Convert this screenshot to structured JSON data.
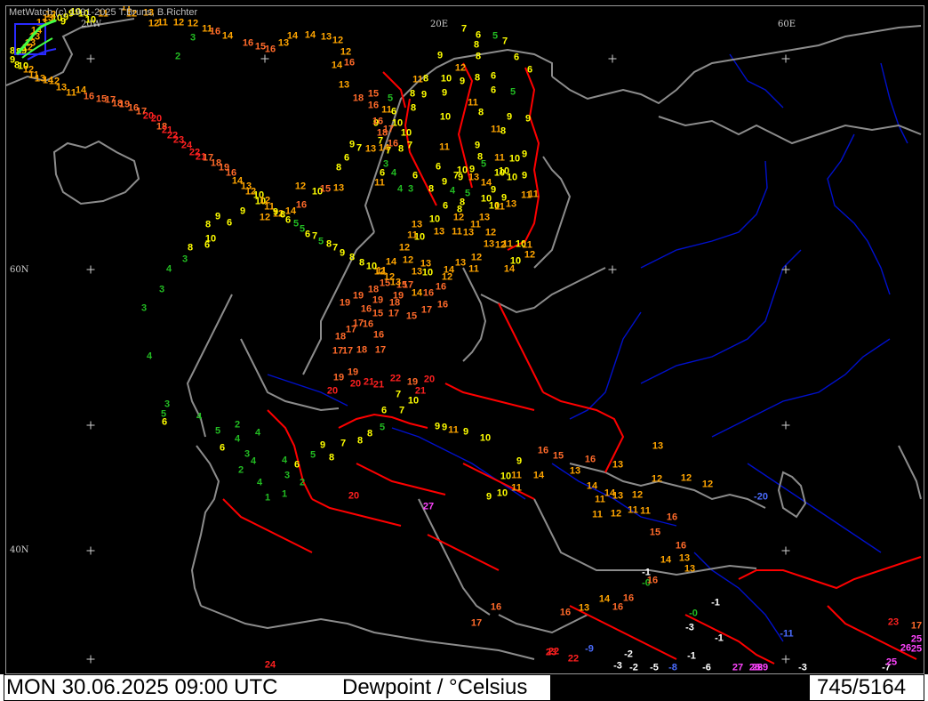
{
  "app": {
    "copyright": "MetWatch  (c) 1991-2025 T.Bruns, B.Richter"
  },
  "status_bar": {
    "datetime": "MON 30.06.2025 09:00 UTC",
    "parameter": "Dewpoint / °Celsius",
    "station_count": "745/5164"
  },
  "graticule_labels": {
    "lon_20w": "20W",
    "lon_20e": "20E",
    "lon_60e": "60E",
    "lat_60n": "60N",
    "lat_40n": "40N"
  },
  "colors": {
    "background": "#000000",
    "coast": "#8c8c8c",
    "border": "#ff0000",
    "river": "#0000cc",
    "value_scale": [
      {
        "max": -8,
        "color": "#4a6cff"
      },
      {
        "max": -1,
        "color": "#ffffff"
      },
      {
        "max": 5,
        "color": "#22bb22"
      },
      {
        "max": 10,
        "color": "#ffff00"
      },
      {
        "max": 14,
        "color": "#ffa500"
      },
      {
        "max": 19,
        "color": "#ff6a2a"
      },
      {
        "max": 24,
        "color": "#ff2020"
      },
      {
        "max": 40,
        "color": "#ff44ff"
      }
    ]
  },
  "observations": [
    {
      "v": "2"
    },
    {
      "v": "3"
    },
    {
      "v": "7"
    },
    {
      "v": "6"
    },
    {
      "v": "5"
    },
    {
      "v": "9"
    },
    {
      "v": "8"
    },
    {
      "v": "6"
    },
    {
      "v": "7"
    },
    {
      "v": "6"
    },
    {
      "v": "9"
    },
    {
      "v": "8"
    },
    {
      "v": "8"
    },
    {
      "v": "10"
    },
    {
      "v": "12"
    },
    {
      "v": "8"
    },
    {
      "v": "6"
    },
    {
      "v": "9"
    },
    {
      "v": "8"
    },
    {
      "v": "11"
    },
    {
      "v": "9"
    },
    {
      "v": "8"
    },
    {
      "v": "6"
    },
    {
      "v": "5"
    },
    {
      "v": "11"
    },
    {
      "v": "10"
    },
    {
      "v": "9"
    },
    {
      "v": "10"
    },
    {
      "v": "11"
    },
    {
      "v": "8"
    },
    {
      "v": "6"
    },
    {
      "v": "5"
    },
    {
      "v": "9"
    },
    {
      "v": "9"
    },
    {
      "v": "11"
    },
    {
      "v": "8"
    },
    {
      "v": "10"
    },
    {
      "v": "7"
    },
    {
      "v": "7"
    },
    {
      "v": "8"
    },
    {
      "v": "7"
    },
    {
      "v": "11"
    },
    {
      "v": "9"
    },
    {
      "v": "8"
    },
    {
      "v": "5"
    },
    {
      "v": "3"
    },
    {
      "v": "6"
    },
    {
      "v": "4"
    },
    {
      "v": "4"
    },
    {
      "v": "3"
    },
    {
      "v": "6"
    },
    {
      "v": "6"
    },
    {
      "v": "9"
    },
    {
      "v": "8"
    },
    {
      "v": "10"
    },
    {
      "v": "9"
    },
    {
      "v": "9"
    },
    {
      "v": "13"
    },
    {
      "v": "14"
    },
    {
      "v": "11"
    },
    {
      "v": "10"
    },
    {
      "v": "10"
    },
    {
      "v": "9"
    },
    {
      "v": "9"
    },
    {
      "v": "11"
    },
    {
      "v": "10"
    },
    {
      "v": "10"
    },
    {
      "v": "9"
    },
    {
      "v": "7"
    },
    {
      "v": "4"
    },
    {
      "v": "5"
    },
    {
      "v": "8"
    },
    {
      "v": "6"
    },
    {
      "v": "8"
    },
    {
      "v": "10"
    },
    {
      "v": "10"
    },
    {
      "v": "9"
    },
    {
      "v": "11"
    },
    {
      "v": "11"
    },
    {
      "v": "13"
    },
    {
      "v": "11"
    },
    {
      "v": "13"
    },
    {
      "v": "12"
    },
    {
      "v": "11"
    },
    {
      "v": "10"
    },
    {
      "v": "13"
    },
    {
      "v": "10"
    },
    {
      "v": "11"
    },
    {
      "v": "12"
    },
    {
      "v": "13"
    },
    {
      "v": "11"
    },
    {
      "v": "13"
    },
    {
      "v": "12"
    },
    {
      "v": "13"
    },
    {
      "v": "12"
    },
    {
      "v": "11"
    },
    {
      "v": "10"
    },
    {
      "v": "11"
    },
    {
      "v": "12"
    },
    {
      "v": "10"
    },
    {
      "v": "14"
    },
    {
      "v": "12"
    },
    {
      "v": "13"
    },
    {
      "v": "11"
    },
    {
      "v": "14"
    },
    {
      "v": "12"
    },
    {
      "v": "10"
    },
    {
      "v": "13"
    },
    {
      "v": "13"
    },
    {
      "v": "12"
    },
    {
      "v": "14"
    },
    {
      "v": "12"
    },
    {
      "v": "15"
    },
    {
      "v": "15"
    },
    {
      "v": "14"
    },
    {
      "v": "16"
    },
    {
      "v": "16"
    },
    {
      "v": "16"
    },
    {
      "v": "17"
    },
    {
      "v": "15"
    },
    {
      "v": "17"
    },
    {
      "v": "15"
    },
    {
      "v": "17"
    },
    {
      "v": "16"
    },
    {
      "v": "16"
    },
    {
      "v": "16"
    },
    {
      "v": "17"
    },
    {
      "v": "18"
    },
    {
      "v": "17"
    },
    {
      "v": "17"
    },
    {
      "v": "18"
    },
    {
      "v": "17"
    },
    {
      "v": "19"
    },
    {
      "v": "19"
    },
    {
      "v": "18"
    },
    {
      "v": "19"
    },
    {
      "v": "18"
    },
    {
      "v": "19"
    },
    {
      "v": "17"
    },
    {
      "v": "19"
    },
    {
      "v": "20"
    },
    {
      "v": "19"
    },
    {
      "v": "20"
    },
    {
      "v": "21"
    },
    {
      "v": "21"
    },
    {
      "v": "22"
    },
    {
      "v": "19"
    },
    {
      "v": "21"
    },
    {
      "v": "20"
    },
    {
      "v": "20"
    },
    {
      "v": "27"
    },
    {
      "v": "-20"
    },
    {
      "v": "-1"
    },
    {
      "v": "-0"
    },
    {
      "v": "-0"
    },
    {
      "v": "-3"
    },
    {
      "v": "-1"
    },
    {
      "v": "-1"
    },
    {
      "v": "-2"
    },
    {
      "v": "-3"
    },
    {
      "v": "-2"
    },
    {
      "v": "-5"
    },
    {
      "v": "-8"
    },
    {
      "v": "-6"
    },
    {
      "v": "-7"
    },
    {
      "v": "-9"
    },
    {
      "v": "-11"
    },
    {
      "v": "-1"
    },
    {
      "v": "-3"
    },
    {
      "v": "25"
    },
    {
      "v": "26"
    },
    {
      "v": "25"
    },
    {
      "v": "25"
    },
    {
      "v": "26"
    },
    {
      "v": "27"
    },
    {
      "v": "29"
    },
    {
      "v": "28"
    },
    {
      "v": "23"
    },
    {
      "v": "22"
    },
    {
      "v": "22"
    },
    {
      "v": "24"
    },
    {
      "v": "23"
    },
    {
      "v": "17"
    },
    {
      "v": "17"
    },
    {
      "v": "16"
    },
    {
      "v": "16"
    },
    {
      "v": "13"
    },
    {
      "v": "14"
    },
    {
      "v": "16"
    },
    {
      "v": "16"
    },
    {
      "v": "16"
    },
    {
      "v": "13"
    },
    {
      "v": "13"
    },
    {
      "v": "14"
    },
    {
      "v": "16"
    },
    {
      "v": "15"
    },
    {
      "v": "16"
    },
    {
      "v": "11"
    },
    {
      "v": "11"
    },
    {
      "v": "12"
    },
    {
      "v": "12"
    },
    {
      "v": "13"
    },
    {
      "v": "14"
    },
    {
      "v": "14"
    },
    {
      "v": "11"
    },
    {
      "v": "11"
    },
    {
      "v": "12"
    },
    {
      "v": "12"
    },
    {
      "v": "12"
    },
    {
      "v": "13"
    },
    {
      "v": "13"
    },
    {
      "v": "16"
    },
    {
      "v": "13"
    },
    {
      "v": "15"
    },
    {
      "v": "16"
    },
    {
      "v": "14"
    },
    {
      "v": "11"
    },
    {
      "v": "10"
    },
    {
      "v": "11"
    },
    {
      "v": "10"
    },
    {
      "v": "9"
    },
    {
      "v": "9"
    },
    {
      "v": "10"
    },
    {
      "v": "9"
    },
    {
      "v": "11"
    },
    {
      "v": "9"
    },
    {
      "v": "9"
    },
    {
      "v": "10"
    },
    {
      "v": "7"
    },
    {
      "v": "7"
    },
    {
      "v": "6"
    },
    {
      "v": "5"
    },
    {
      "v": "8"
    },
    {
      "v": "8"
    },
    {
      "v": "7"
    },
    {
      "v": "9"
    },
    {
      "v": "8"
    },
    {
      "v": "5"
    },
    {
      "v": "6"
    },
    {
      "v": "4"
    },
    {
      "v": "3"
    },
    {
      "v": "2"
    },
    {
      "v": "1"
    },
    {
      "v": "1"
    },
    {
      "v": "4"
    },
    {
      "v": "4"
    },
    {
      "v": "2"
    },
    {
      "v": "3"
    },
    {
      "v": "4"
    },
    {
      "v": "2"
    },
    {
      "v": "4"
    },
    {
      "v": "6"
    },
    {
      "v": "5"
    },
    {
      "v": "4"
    },
    {
      "v": "6"
    },
    {
      "v": "5"
    },
    {
      "v": "3"
    },
    {
      "v": "4"
    },
    {
      "v": "3"
    },
    {
      "v": "3"
    },
    {
      "v": "4"
    },
    {
      "v": "3"
    },
    {
      "v": "8"
    },
    {
      "v": "6"
    },
    {
      "v": "10"
    },
    {
      "v": "8"
    },
    {
      "v": "9"
    },
    {
      "v": "6"
    },
    {
      "v": "9"
    },
    {
      "v": "10"
    },
    {
      "v": "12"
    },
    {
      "v": "12"
    },
    {
      "v": "14"
    },
    {
      "v": "16"
    },
    {
      "v": "12"
    },
    {
      "v": "10"
    },
    {
      "v": "15"
    },
    {
      "v": "13"
    },
    {
      "v": "8"
    },
    {
      "v": "6"
    },
    {
      "v": "9"
    },
    {
      "v": "7"
    },
    {
      "v": "13"
    },
    {
      "v": "14"
    },
    {
      "v": "16"
    },
    {
      "v": "17"
    },
    {
      "v": "18"
    },
    {
      "v": "16"
    },
    {
      "v": "16"
    },
    {
      "v": "15"
    },
    {
      "v": "18"
    },
    {
      "v": "13"
    },
    {
      "v": "14"
    },
    {
      "v": "16"
    },
    {
      "v": "12"
    },
    {
      "v": "12"
    },
    {
      "v": "13"
    },
    {
      "v": "14"
    },
    {
      "v": "14"
    },
    {
      "v": "13"
    },
    {
      "v": "16"
    },
    {
      "v": "15"
    },
    {
      "v": "16"
    },
    {
      "v": "14"
    },
    {
      "v": "16"
    },
    {
      "v": "11"
    },
    {
      "v": "12"
    },
    {
      "v": "12"
    },
    {
      "v": "11"
    },
    {
      "v": "12"
    },
    {
      "v": "13"
    },
    {
      "v": "12"
    },
    {
      "v": "11"
    },
    {
      "v": "11"
    },
    {
      "v": "10"
    },
    {
      "v": "10"
    },
    {
      "v": "10"
    },
    {
      "v": "9"
    },
    {
      "v": "9"
    },
    {
      "v": "9"
    },
    {
      "v": "10"
    },
    {
      "v": "12"
    },
    {
      "v": "13"
    },
    {
      "v": "13"
    },
    {
      "v": "14"
    },
    {
      "v": "13"
    },
    {
      "v": "13"
    },
    {
      "v": "12"
    },
    {
      "v": "9"
    },
    {
      "v": "8"
    },
    {
      "v": "8"
    },
    {
      "v": "9"
    },
    {
      "v": "8"
    },
    {
      "v": "10"
    },
    {
      "v": "12"
    },
    {
      "v": "11"
    },
    {
      "v": "13"
    },
    {
      "v": "14"
    },
    {
      "v": "12"
    },
    {
      "v": "13"
    },
    {
      "v": "11"
    },
    {
      "v": "14"
    },
    {
      "v": "16"
    },
    {
      "v": "15"
    },
    {
      "v": "17"
    },
    {
      "v": "18"
    },
    {
      "v": "19"
    },
    {
      "v": "16"
    },
    {
      "v": "17"
    },
    {
      "v": "20"
    },
    {
      "v": "20"
    },
    {
      "v": "18"
    },
    {
      "v": "21"
    },
    {
      "v": "22"
    },
    {
      "v": "23"
    },
    {
      "v": "24"
    },
    {
      "v": "22"
    },
    {
      "v": "21"
    },
    {
      "v": "17"
    },
    {
      "v": "18"
    },
    {
      "v": "19"
    },
    {
      "v": "16"
    },
    {
      "v": "14"
    },
    {
      "v": "13"
    },
    {
      "v": "12"
    },
    {
      "v": "10"
    },
    {
      "v": "12"
    },
    {
      "v": "11"
    },
    {
      "v": "9"
    },
    {
      "v": "8"
    },
    {
      "v": "6"
    },
    {
      "v": "5"
    },
    {
      "v": "5"
    },
    {
      "v": "6"
    },
    {
      "v": "7"
    },
    {
      "v": "5"
    },
    {
      "v": "8"
    },
    {
      "v": "7"
    },
    {
      "v": "9"
    },
    {
      "v": "8"
    },
    {
      "v": "8"
    },
    {
      "v": "10"
    },
    {
      "v": "11"
    },
    {
      "v": "12"
    },
    {
      "v": "13"
    },
    {
      "v": "14"
    },
    {
      "v": "16"
    },
    {
      "v": "15"
    },
    {
      "v": "16"
    },
    {
      "v": "16"
    },
    {
      "v": "17"
    },
    {
      "v": "19"
    },
    {
      "v": "20"
    },
    {
      "v": "19"
    },
    {
      "v": "18"
    },
    {
      "v": "17"
    },
    {
      "v": "21"
    },
    {
      "v": "22"
    },
    {
      "v": "19"
    },
    {
      "v": "17"
    },
    {
      "v": "16"
    },
    {
      "v": "15"
    },
    {
      "v": "14"
    },
    {
      "v": "13"
    },
    {
      "v": "11"
    },
    {
      "v": "10"
    },
    {
      "v": "9"
    },
    {
      "v": "8"
    },
    {
      "v": "7"
    },
    {
      "v": "6"
    },
    {
      "v": "7"
    },
    {
      "v": "6"
    },
    {
      "v": "5"
    },
    {
      "v": "5"
    },
    {
      "v": "7"
    },
    {
      "v": "6"
    },
    {
      "v": "8"
    },
    {
      "v": "9"
    },
    {
      "v": "11"
    },
    {
      "v": "13"
    },
    {
      "v": "12"
    },
    {
      "v": "15"
    },
    {
      "v": "14"
    },
    {
      "v": "12"
    },
    {
      "v": "11"
    },
    {
      "v": "13"
    },
    {
      "v": "14"
    },
    {
      "v": "9"
    },
    {
      "v": "10"
    },
    {
      "v": "12"
    },
    {
      "v": "16"
    },
    {
      "v": "18"
    },
    {
      "v": "17"
    },
    {
      "v": "19"
    },
    {
      "v": "20"
    },
    {
      "v": "22"
    },
    {
      "v": "21"
    },
    {
      "v": "16"
    },
    {
      "v": "13"
    },
    {
      "v": "11"
    },
    {
      "v": "9"
    },
    {
      "v": "8"
    },
    {
      "v": "8"
    },
    {
      "v": "6"
    },
    {
      "v": "8"
    },
    {
      "v": "11"
    },
    {
      "v": "13"
    },
    {
      "v": "10"
    },
    {
      "v": "11"
    },
    {
      "v": "12"
    },
    {
      "v": "15"
    },
    {
      "v": "16"
    },
    {
      "v": "17"
    },
    {
      "v": "18"
    },
    {
      "v": "19"
    },
    {
      "v": "16"
    },
    {
      "v": "14"
    },
    {
      "v": "12"
    },
    {
      "v": "9"
    },
    {
      "v": "9"
    },
    {
      "v": "7"
    },
    {
      "v": "6"
    },
    {
      "v": "8"
    },
    {
      "v": "10"
    },
    {
      "v": "13"
    },
    {
      "v": "12"
    },
    {
      "v": "11"
    },
    {
      "v": "9"
    }
  ]
}
